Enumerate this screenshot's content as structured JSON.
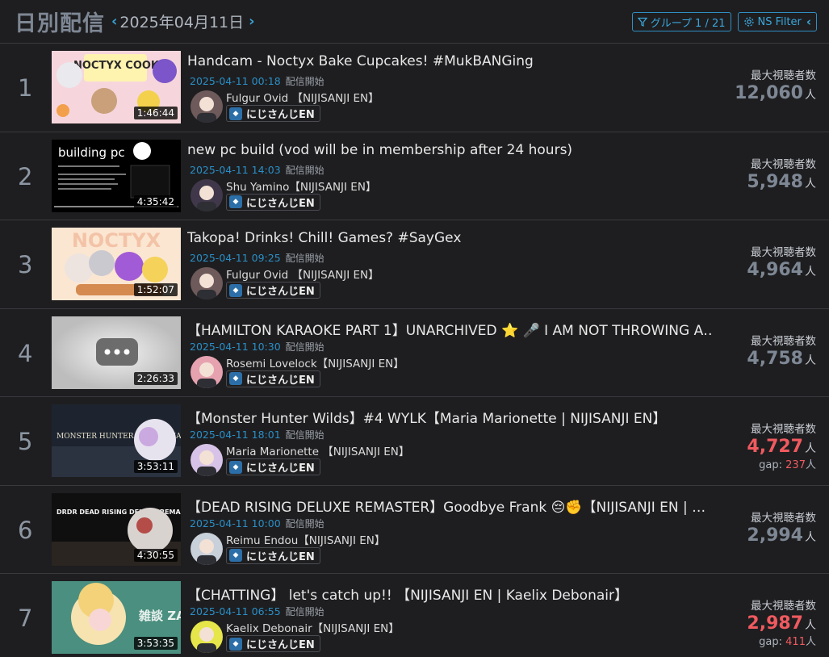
{
  "header": {
    "title": "日別配信",
    "date": "2025年04月11日",
    "group_button": "グループ 1 / 21",
    "filter_button": "NS Filter"
  },
  "colors": {
    "accent": "#38a3d6",
    "hot": "#f05a5f",
    "muted": "#7e8794",
    "background": "#1e1e20"
  },
  "labels": {
    "max_viewers": "最大視聴者数",
    "unit": "人",
    "stream_start": "配信開始",
    "gap": "gap: "
  },
  "streams": [
    {
      "rank": "1",
      "title": "Handcam - Noctyx Bake Cupcakes! #MukBANGing",
      "time": "2025-04-11 00:18",
      "channel": "Fulgur Ovid 【NIJISANJI EN】",
      "group": "にじさんじEN",
      "duration": "1:46:44",
      "viewers": "12,060",
      "gap": null,
      "hot": false,
      "thumb_text": "NOCTYX COOK"
    },
    {
      "rank": "2",
      "title": "new pc build (vod will be in membership after 24 hours)",
      "time": "2025-04-11 14:03",
      "channel": "Shu Yamino【NIJISANJI EN】",
      "group": "にじさんじEN",
      "duration": "4:35:42",
      "viewers": "5,948",
      "gap": null,
      "hot": false,
      "thumb_text": "building pc"
    },
    {
      "rank": "3",
      "title": "Takopa! Drinks! Chill! Games? #SayGex",
      "time": "2025-04-11 09:25",
      "channel": "Fulgur Ovid 【NIJISANJI EN】",
      "group": "にじさんじEN",
      "duration": "1:52:07",
      "viewers": "4,964",
      "gap": null,
      "hot": false,
      "thumb_text": "NOCTYX"
    },
    {
      "rank": "4",
      "title": "【HAMILTON KARAOKE PART 1】UNARCHIVED ⭐ 🎤 I AM NOT THROWING A…",
      "time": "2025-04-11 10:30",
      "channel": "Rosemi Lovelock【NIJISANJI EN】",
      "group": "にじさんじEN",
      "duration": "2:26:33",
      "viewers": "4,758",
      "gap": null,
      "hot": false,
      "thumb_text": ""
    },
    {
      "rank": "5",
      "title": "【Monster Hunter Wilds】#4 WYLK【Maria Marionette | NIJISANJI EN】",
      "time": "2025-04-11 18:01",
      "channel": "Maria Marionette 【NIJISANJI EN】",
      "group": "にじさんじEN",
      "duration": "3:53:11",
      "viewers": "4,727",
      "gap": "237",
      "hot": true,
      "thumb_text": "MONSTER HUNTER WILDS CHAPTER 3"
    },
    {
      "rank": "6",
      "title": "【DEAD RISING DELUXE REMASTER】Goodbye Frank 😔✊【NIJISANJI EN | …",
      "time": "2025-04-11 10:00",
      "channel": "Reimu Endou【NIJISANJI EN】",
      "group": "にじさんじEN",
      "duration": "4:30:55",
      "viewers": "2,994",
      "gap": null,
      "hot": false,
      "thumb_text": "DRDR DEAD RISING DELUXE REMASTER #3"
    },
    {
      "rank": "7",
      "title": "【CHATTING】 let's catch up!! 【NIJISANJI EN | Kaelix Debonair】",
      "time": "2025-04-11 06:55",
      "channel": "Kaelix Debonair【NIJISANJI EN】",
      "group": "にじさんじEN",
      "duration": "3:53:35",
      "viewers": "2,987",
      "gap": "411",
      "hot": true,
      "thumb_text": "雑談 ZATSU"
    }
  ]
}
